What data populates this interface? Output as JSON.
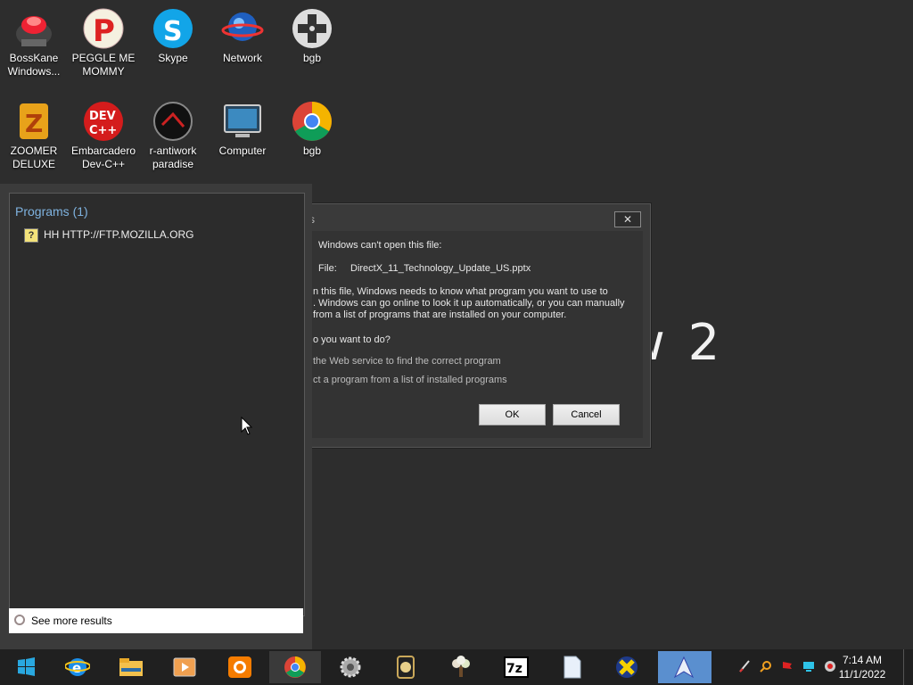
{
  "desktop": {
    "background_text": "w 2",
    "icons": [
      {
        "label": "BossKane Windows..."
      },
      {
        "label": "PEGGLE ME MOMMY"
      },
      {
        "label": "Skype"
      },
      {
        "label": "Network"
      },
      {
        "label": "bgb"
      },
      {
        "label": "ZOOMER DELUXE"
      },
      {
        "label": "Embarcadero Dev-C++"
      },
      {
        "label": "r-antiwork paradise"
      },
      {
        "label": "Computer"
      },
      {
        "label": "bgb"
      }
    ]
  },
  "dialog": {
    "title_fragment": "s",
    "close_label": "✕",
    "line1": "Windows can't open this file:",
    "file_label": "File:",
    "file_name": "DirectX_11_Technology_Update_US.pptx",
    "para1_line1": "n this file, Windows needs to know what program you want to use to",
    "para1_line2": ". Windows can go online to look it up automatically, or you can manually",
    "para1_line3": "from a list of programs that are installed on your computer.",
    "question": "o you want to do?",
    "option1": " the Web service to find the correct program",
    "option2": "ct a program from a list of installed programs",
    "ok_label": "OK",
    "cancel_label": "Cancel"
  },
  "start_search": {
    "programs_heading": "Programs (1)",
    "program_item": "HH HTTP://FTP.MOZILLA.ORG",
    "see_more": "See more results"
  },
  "taskbar": {
    "clock_time": "7:14 AM",
    "clock_date": "11/1/2022"
  }
}
